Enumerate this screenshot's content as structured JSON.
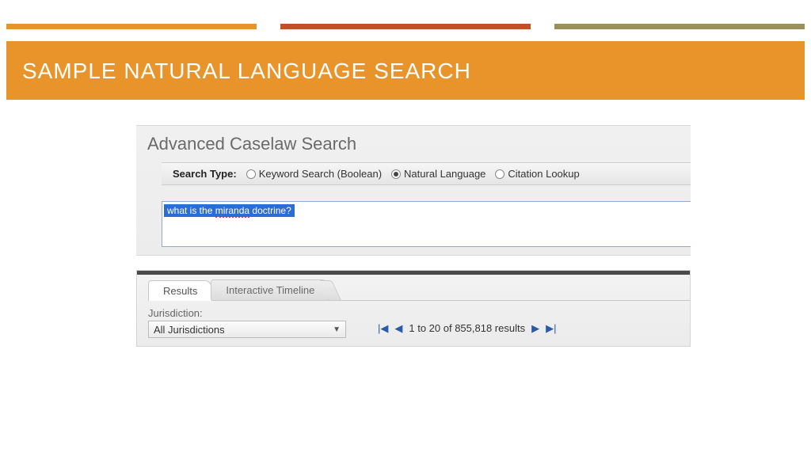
{
  "slide": {
    "title": "SAMPLE NATURAL LANGUAGE SEARCH"
  },
  "search_panel": {
    "heading": "Advanced Caselaw Search",
    "type_label": "Search Type:",
    "options": {
      "keyword": "Keyword Search (Boolean)",
      "natural": "Natural Language",
      "citation": "Citation Lookup"
    },
    "query_pre": "what is the ",
    "query_err": "miranda",
    "query_post": " doctrine?"
  },
  "results_panel": {
    "tabs": {
      "results": "Results",
      "timeline": "Interactive Timeline"
    },
    "jurisdiction_label": "Jurisdiction:",
    "jurisdiction_value": "All Jurisdictions",
    "pager_text": "1 to 20 of 855,818 results"
  }
}
